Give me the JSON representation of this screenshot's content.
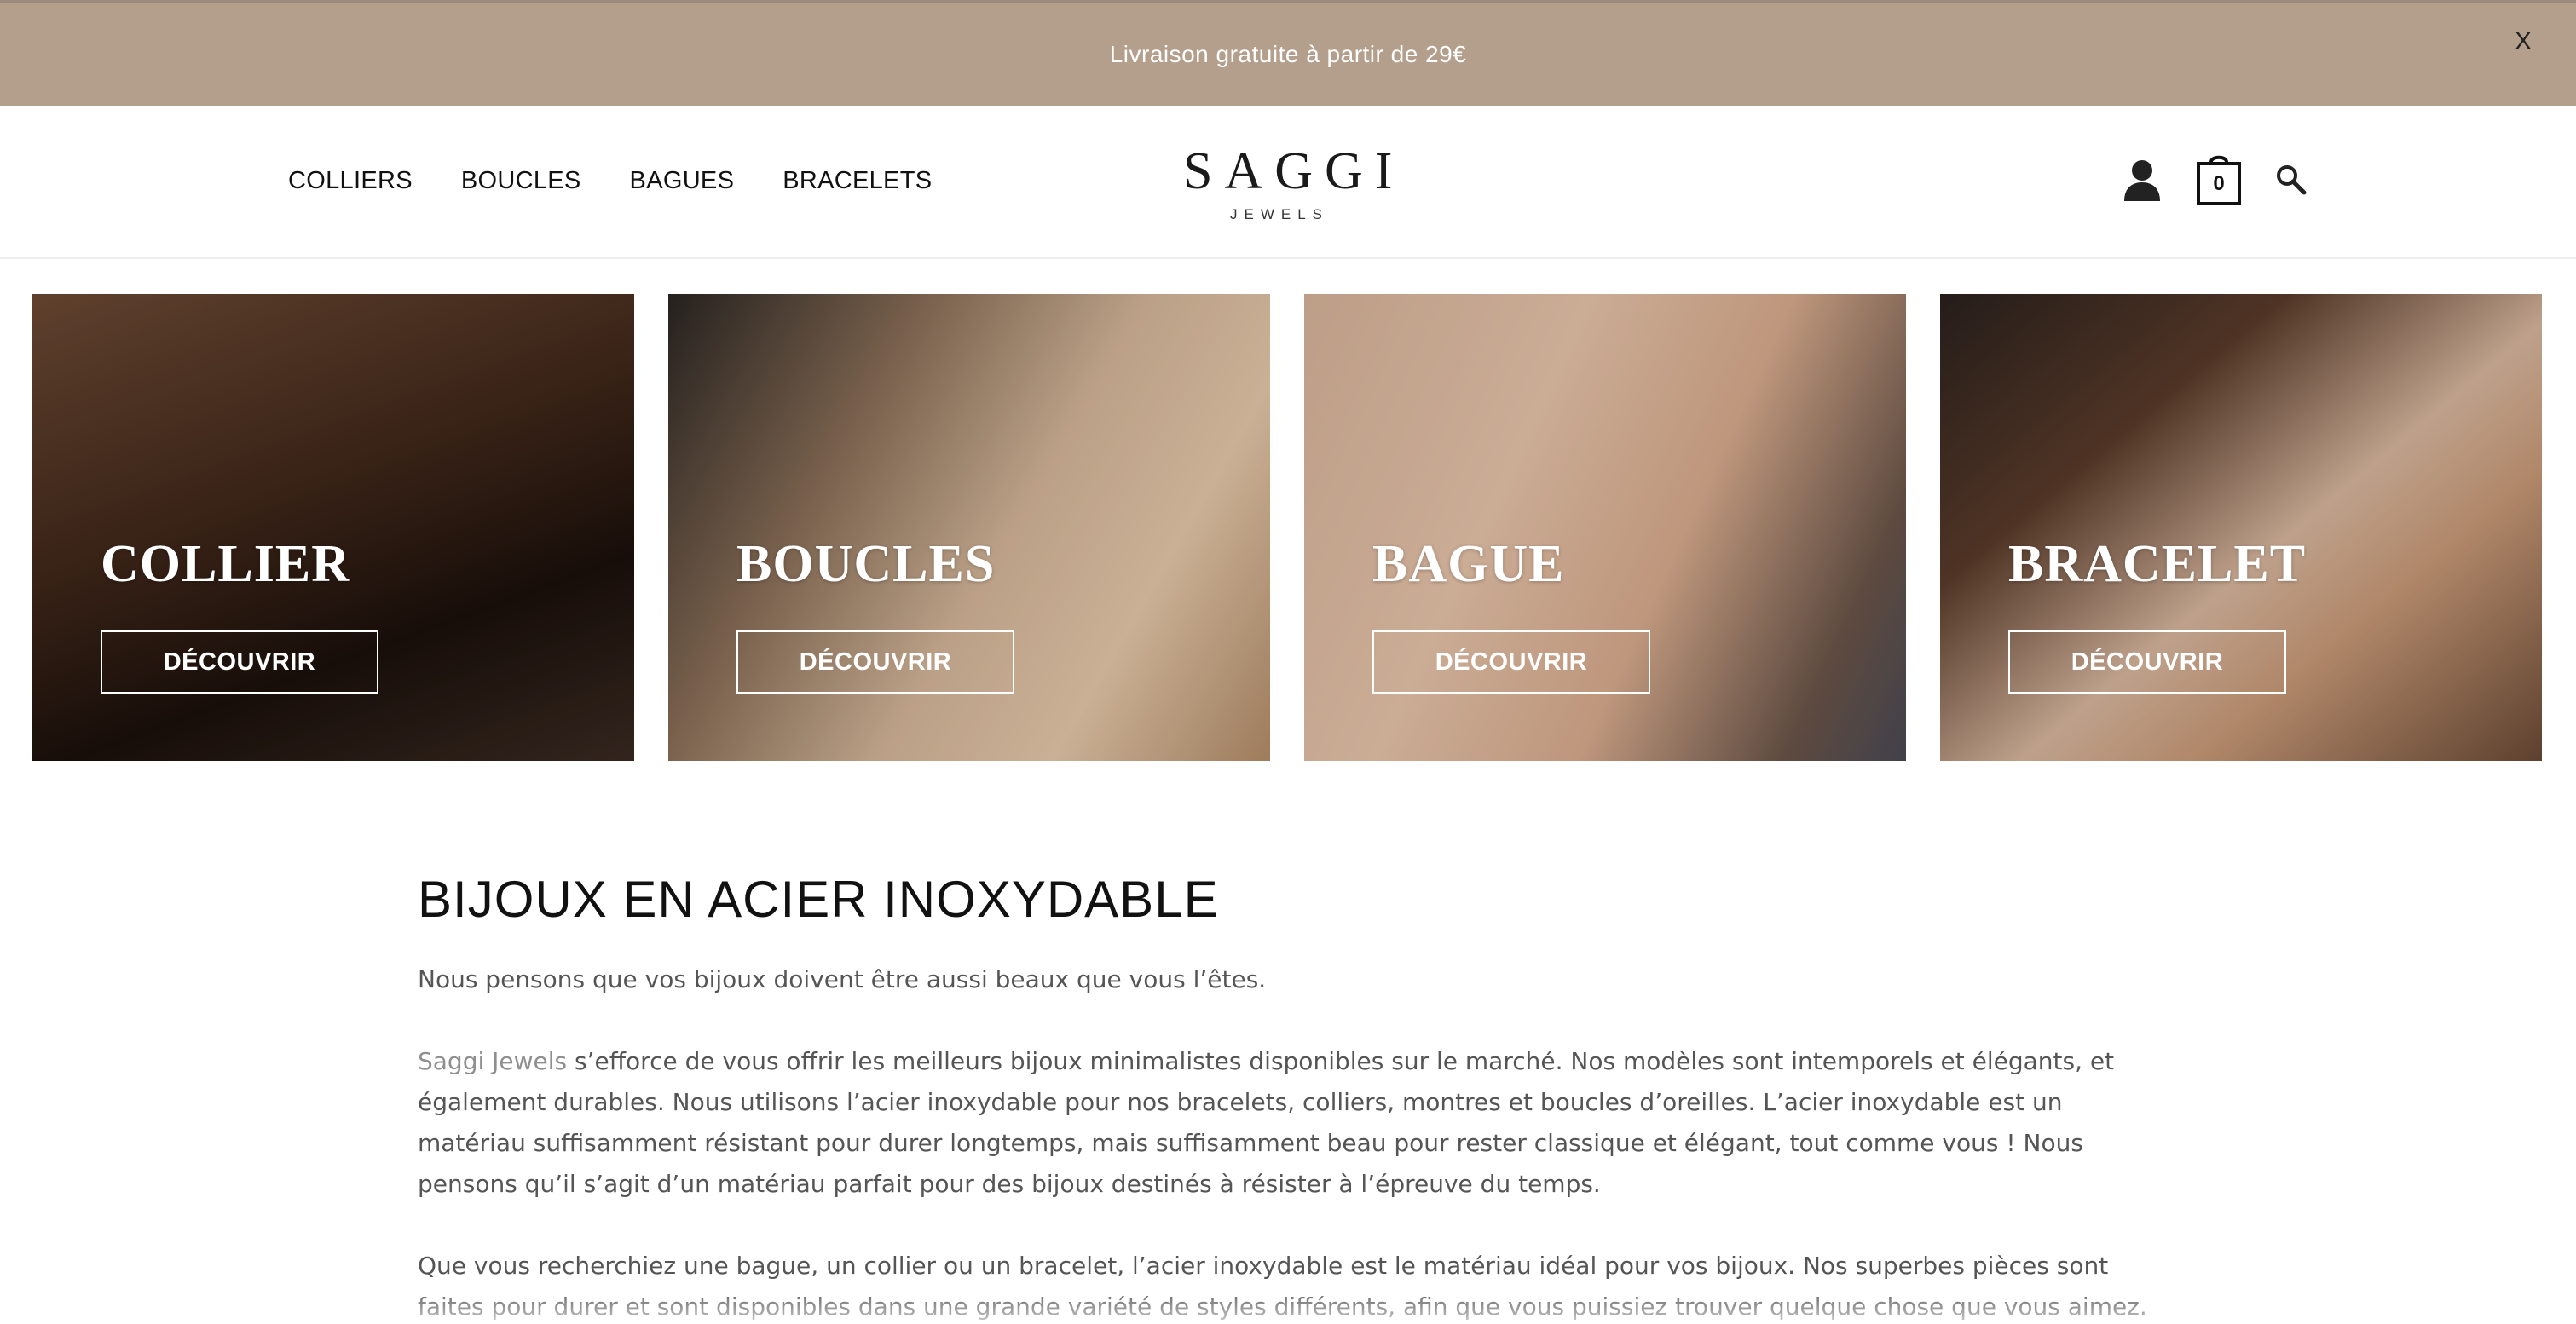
{
  "promo": {
    "text": "Livraison gratuite à partir de 29€",
    "close_label": "X"
  },
  "header": {
    "nav": [
      "COLLIERS",
      "BOUCLES",
      "BAGUES",
      "BRACELETS"
    ],
    "logo_main": "SAGGI",
    "logo_sub": "JEWELS",
    "cart_count": "0",
    "icons": [
      "user-icon",
      "cart-icon",
      "search-icon"
    ]
  },
  "categories": [
    {
      "title": "COLLIER",
      "button": "DÉCOUVRIR"
    },
    {
      "title": "BOUCLES",
      "button": "DÉCOUVRIR"
    },
    {
      "title": "BAGUE",
      "button": "DÉCOUVRIR"
    },
    {
      "title": "BRACELET",
      "button": "DÉCOUVRIR"
    }
  ],
  "content": {
    "title": "BIJOUX EN ACIER INOXYDABLE",
    "p1": "Nous pensons que vos bijoux doivent être aussi beaux que vous l’êtes.",
    "p2_link": "Saggi Jewels",
    "p2_rest": " s’efforce de vous offrir les meilleurs bijoux minimalistes disponibles sur le marché. Nos modèles sont intemporels et élégants, et également durables. Nous utilisons l’acier inoxydable pour nos bracelets, colliers, montres et boucles d’oreilles. L’acier inoxydable est un matériau suffisamment résistant pour durer longtemps, mais suffisamment beau pour rester classique et élégant, tout comme vous ! Nous pensons qu’il s’agit d’un matériau parfait pour des bijoux destinés à résister à l’épreuve du temps.",
    "p3": "Que vous recherchiez une bague, un collier ou un bracelet, l’acier inoxydable est le matériau idéal pour vos bijoux. Nos superbes pièces sont faites pour durer et sont disponibles dans une grande variété de styles différents, afin que vous puissiez trouver quelque chose que vous aimez."
  },
  "colors": {
    "promo_bg": "#b39f8b",
    "text_gray": "#555555",
    "link_gray": "#8f8f8f"
  }
}
